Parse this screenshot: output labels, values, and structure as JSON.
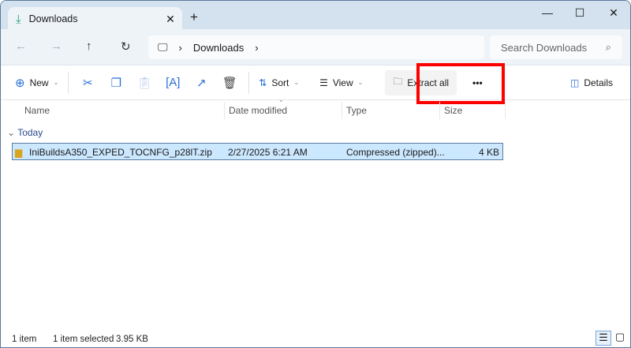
{
  "window": {
    "tab_title": "Downloads",
    "tab_icon": "download-icon",
    "new_tab": "+",
    "minimize": "—",
    "maximize": "☐",
    "close": "✕"
  },
  "address": {
    "breadcrumb": [
      "Downloads"
    ],
    "search_placeholder": "Search Downloads"
  },
  "toolbar": {
    "new_label": "New",
    "sort_label": "Sort",
    "view_label": "View",
    "extract_label": "Extract all",
    "more": "•••",
    "details_label": "Details"
  },
  "columns": [
    "Name",
    "Date modified",
    "Type",
    "Size"
  ],
  "groups": [
    {
      "label": "Today",
      "files": [
        {
          "name": "IniBuildsA350_EXPED_TOCNFG_p28lT.zip",
          "date": "2/27/2025 6:21 AM",
          "type": "Compressed (zipped)...",
          "size": "4 KB",
          "selected": true
        }
      ]
    }
  ],
  "status": {
    "count": "1 item",
    "selected": "1 item selected",
    "size": "3.95 KB"
  },
  "colors": {
    "highlight": "#ff0000",
    "selection": "#cce8ff",
    "accent": "#2a6fd6"
  }
}
